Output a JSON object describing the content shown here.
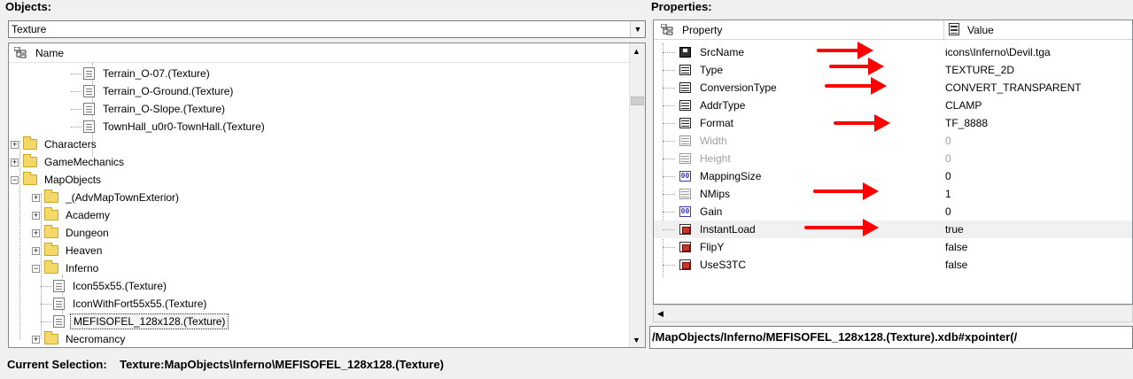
{
  "objects_panel": {
    "title": "Objects:",
    "type_combo_value": "Texture",
    "column_header": "Name",
    "tree_items": [
      {
        "label": "Terrain_O-07.(Texture)",
        "kind": "texture"
      },
      {
        "label": "Terrain_O-Ground.(Texture)",
        "kind": "texture"
      },
      {
        "label": "Terrain_O-Slope.(Texture)",
        "kind": "texture"
      },
      {
        "label": "TownHall_u0r0-TownHall.(Texture)",
        "kind": "texture"
      },
      {
        "label": "Characters",
        "kind": "folder",
        "expander": "+"
      },
      {
        "label": "GameMechanics",
        "kind": "folder",
        "expander": "+"
      },
      {
        "label": "MapObjects",
        "kind": "folder",
        "expander": "-"
      },
      {
        "label": "_(AdvMapTownExterior)",
        "kind": "folder",
        "expander": "+"
      },
      {
        "label": "Academy",
        "kind": "folder",
        "expander": "+"
      },
      {
        "label": "Dungeon",
        "kind": "folder",
        "expander": "+"
      },
      {
        "label": "Heaven",
        "kind": "folder",
        "expander": "+"
      },
      {
        "label": "Inferno",
        "kind": "folder",
        "expander": "-"
      },
      {
        "label": "Icon55x55.(Texture)",
        "kind": "texture"
      },
      {
        "label": "IconWithFort55x55.(Texture)",
        "kind": "texture"
      },
      {
        "label": "MEFISOFEL_128x128.(Texture)",
        "kind": "texture",
        "selected": true
      },
      {
        "label": "Necromancy",
        "kind": "folder",
        "expander": "+"
      }
    ]
  },
  "properties_panel": {
    "title": "Properties:",
    "header_property": "Property",
    "header_value": "Value",
    "rows": [
      {
        "name": "SrcName",
        "value": "icons\\Inferno\\Devil.tga",
        "icon": "save",
        "arrow": true
      },
      {
        "name": "Type",
        "value": "TEXTURE_2D",
        "icon": "enum",
        "arrow": true
      },
      {
        "name": "ConversionType",
        "value": "CONVERT_TRANSPARENT",
        "icon": "enum",
        "arrow": true
      },
      {
        "name": "AddrType",
        "value": "CLAMP",
        "icon": "enum"
      },
      {
        "name": "Format",
        "value": "TF_8888",
        "icon": "enum",
        "arrow": true
      },
      {
        "name": "Width",
        "value": "0",
        "icon": "int",
        "disabled": true
      },
      {
        "name": "Height",
        "value": "0",
        "icon": "int",
        "disabled": true
      },
      {
        "name": "MappingSize",
        "value": "0",
        "icon": "num"
      },
      {
        "name": "NMips",
        "value": "1",
        "icon": "int",
        "arrow": true
      },
      {
        "name": "Gain",
        "value": "0",
        "icon": "num"
      },
      {
        "name": "InstantLoad",
        "value": "true",
        "icon": "bool",
        "arrow": true,
        "highlight": true
      },
      {
        "name": "FlipY",
        "value": "false",
        "icon": "bool"
      },
      {
        "name": "UseS3TC",
        "value": "false",
        "icon": "bool"
      }
    ],
    "path": "/MapObjects/Inferno/MEFISOFEL_128x128.(Texture).xdb#xpointer(/"
  },
  "current_selection": {
    "label": "Current Selection:",
    "value": "Texture:MapObjects\\Inferno\\MEFISOFEL_128x128.(Texture)"
  },
  "colors": {
    "annotation_arrow": "#ff0000",
    "folder": "#f4d86a"
  }
}
